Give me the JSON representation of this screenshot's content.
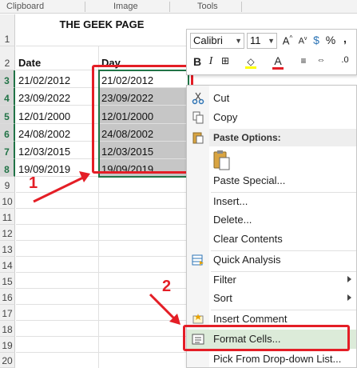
{
  "ribbon": {
    "groups": [
      "Clipboard",
      "Image",
      "Tools"
    ]
  },
  "sheet": {
    "title": "THE GEEK PAGE",
    "headers": {
      "a": "Date",
      "b": "Day"
    },
    "row_numbers": [
      "1",
      "2",
      "3",
      "4",
      "5",
      "6",
      "7",
      "8",
      "9",
      "10",
      "11",
      "12",
      "13",
      "14",
      "15",
      "16",
      "17",
      "18",
      "19",
      "20"
    ],
    "rows": [
      {
        "date": "21/02/2012",
        "day": "21/02/2012"
      },
      {
        "date": "23/09/2022",
        "day": "23/09/2022"
      },
      {
        "date": "12/01/2000",
        "day": "12/01/2000"
      },
      {
        "date": "24/08/2002",
        "day": "24/08/2002"
      },
      {
        "date": "12/03/2015",
        "day": "12/03/2015"
      },
      {
        "date": "19/09/2019",
        "day": "19/09/2019"
      }
    ]
  },
  "annotations": {
    "step1": "1",
    "step2": "2"
  },
  "mini_toolbar": {
    "font": "Calibri",
    "size": "11",
    "bold": "B",
    "italic": "I",
    "font_color_letter": "A",
    "currency": "$",
    "percent": "%",
    "comma": ","
  },
  "context_menu": {
    "items": {
      "cut": "Cut",
      "copy": "Copy",
      "paste_options": "Paste Options:",
      "paste_special": "Paste Special...",
      "insert": "Insert...",
      "delete": "Delete...",
      "clear_contents": "Clear Contents",
      "quick_analysis": "Quick Analysis",
      "filter": "Filter",
      "sort": "Sort",
      "insert_comment": "Insert Comment",
      "format_cells": "Format Cells...",
      "pick_from_list": "Pick From Drop-down List..."
    }
  },
  "colors": {
    "highlight_red": "#e41e26",
    "excel_green": "#217346",
    "selection_gray": "#c6c6c6",
    "menu_hover": "#dcebd9"
  }
}
